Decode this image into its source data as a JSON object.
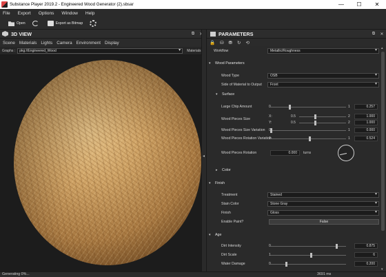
{
  "window": {
    "title": "Substance Player 2019.2 - Engineered Wood Generator (2).sbsar",
    "minimize": "—",
    "maximize": "☐",
    "close": "✕"
  },
  "menu": [
    "File",
    "Export",
    "Options",
    "Window",
    "Help"
  ],
  "toolbar": {
    "open": "Open",
    "export_bitmap": "Export as Bitmap",
    "icons": [
      "folder-icon",
      "refresh-icon",
      "camera-icon",
      "gear-icon"
    ]
  },
  "view3d": {
    "title": "3D VIEW",
    "tabs": [
      "Scene",
      "Materials",
      "Lights",
      "Camera",
      "Environment",
      "Display"
    ],
    "graph_label": "Graphs :",
    "graph_value": "pkg://Engineered_Wood",
    "materials_label": "Materials"
  },
  "parameters": {
    "title": "PARAMETERS",
    "workflow_label": "Workflow",
    "workflow_value": "Metallic/Roughness",
    "wood_params_section": "Wood Parameters",
    "wood_type_label": "Wood Type",
    "wood_type_value": "OSB",
    "side_label": "Side of Material to Output",
    "side_value": "Front",
    "surface_section": "Surface",
    "chip_amount_label": "Large Chip Amount",
    "chip_amount_min": "0",
    "chip_amount_max": "1",
    "chip_amount_value": "0.257",
    "chip_amount_pos": 0.257,
    "pieces_size_label": "Wood Pieces Size",
    "pieces_size_x_label": "X:",
    "pieces_size_y_label": "Y:",
    "pieces_size_min": "0.5",
    "pieces_size_max": "2",
    "pieces_size_x": "1.000",
    "pieces_size_y": "1.000",
    "size_variation_label": "Wood Pieces Size Variation",
    "size_variation_min": "0",
    "size_variation_max": "1",
    "size_variation_value": "0.000",
    "rot_variation_label": "Wood Pieces Rotation Variation",
    "rot_variation_min": "0",
    "rot_variation_max": "1",
    "rot_variation_value": "0.524",
    "rot_variation_pos": 0.524,
    "rotation_label": "Wood Pieces Rotation",
    "rotation_value": "0.000",
    "rotation_unit": "turns",
    "color_section": "Color",
    "finish_section": "Finish",
    "treatment_label": "Treatment",
    "treatment_value": "Stained",
    "stain_label": "Stain Color",
    "stain_value": "Stone Gray",
    "finish_label": "Finish",
    "finish_value": "Gloss",
    "enable_paint_label": "Enable Paint?",
    "enable_paint_value": "False",
    "age_section": "Age",
    "dirt_intensity_label": "Dirt Intensity",
    "dirt_intensity_min": "0",
    "dirt_intensity_value": "0.875",
    "dirt_scale_label": "Dirt Scale",
    "dirt_scale_min": "1",
    "dirt_scale_value": "6",
    "water_damage_label": "Water Damage",
    "water_damage_min": "0",
    "water_damage_value": "0.200"
  },
  "status": {
    "text": "Generating 0%...",
    "memory": "3691 ms"
  }
}
